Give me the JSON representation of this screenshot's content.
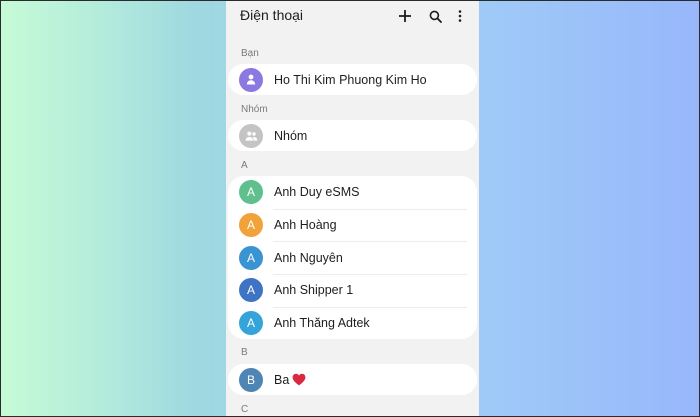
{
  "header": {
    "title": "Điện thoại",
    "actions": [
      {
        "name": "add-icon",
        "icon": "plus"
      },
      {
        "name": "search-icon",
        "icon": "search"
      },
      {
        "name": "more-icon",
        "icon": "vertical-dots"
      }
    ]
  },
  "sections": {
    "ban": {
      "label": "Bạn",
      "contacts": [
        {
          "name": "Ho Thi Kim Phuong Kim Ho",
          "avatar_icon": "person-icon",
          "avatar_color": "#8b78e0"
        }
      ]
    },
    "nhom": {
      "label": "Nhóm",
      "contacts": [
        {
          "name": "Nhóm",
          "avatar_icon": "group-icon",
          "avatar_color": "#c4c4c4"
        }
      ]
    },
    "a": {
      "label": "A",
      "contacts": [
        {
          "name": "Anh Duy eSMS",
          "initial": "A",
          "avatar_color": "#5fbf8d"
        },
        {
          "name": "Anh Hoàng",
          "initial": "A",
          "avatar_color": "#f2a23a"
        },
        {
          "name": "Anh Nguyên",
          "initial": "A",
          "avatar_color": "#3a93d3"
        },
        {
          "name": "Anh Shipper 1",
          "initial": "A",
          "avatar_color": "#3f74c4"
        },
        {
          "name": "Anh Thăng Adtek",
          "initial": "A",
          "avatar_color": "#35a4d8"
        }
      ]
    },
    "b": {
      "label": "B",
      "contacts": [
        {
          "name": "Ba",
          "initial": "B",
          "avatar_color": "#4f85b5",
          "emoji_icon": "red-heart-icon"
        }
      ]
    },
    "c": {
      "label": "C"
    }
  },
  "colors": {
    "heart": "#d9283f"
  }
}
